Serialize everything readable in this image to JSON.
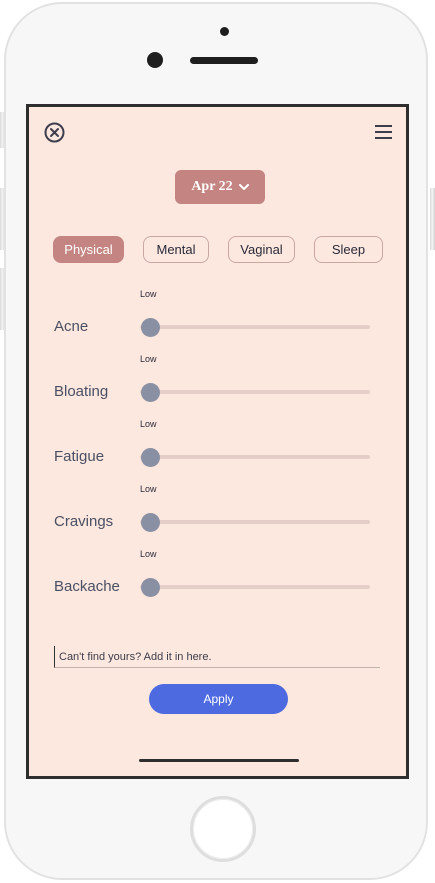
{
  "header": {
    "close_icon": "close-circle-icon",
    "menu_icon": "hamburger-menu-icon"
  },
  "date_selector": {
    "label": "Apr 22",
    "icon": "chevron-down-icon"
  },
  "tabs": [
    {
      "label": "Physical",
      "active": true
    },
    {
      "label": "Mental",
      "active": false
    },
    {
      "label": "Vaginal",
      "active": false
    },
    {
      "label": "Sleep",
      "active": false
    }
  ],
  "symptoms": [
    {
      "name": "Acne",
      "level_label": "Low",
      "value": 0
    },
    {
      "name": "Bloating",
      "level_label": "Low",
      "value": 0
    },
    {
      "name": "Fatigue",
      "level_label": "Low",
      "value": 0
    },
    {
      "name": "Cravings",
      "level_label": "Low",
      "value": 0
    },
    {
      "name": "Backache",
      "level_label": "Low",
      "value": 0
    }
  ],
  "custom_symptom": {
    "placeholder": "Can't find yours? Add it in here.",
    "value": ""
  },
  "apply_button": {
    "label": "Apply"
  },
  "colors": {
    "screen_background": "#fde8df",
    "accent_rose": "#c48481",
    "apply_blue": "#4e6ae0",
    "slider_thumb": "#8a90a3",
    "slider_track": "#e5cec7"
  }
}
